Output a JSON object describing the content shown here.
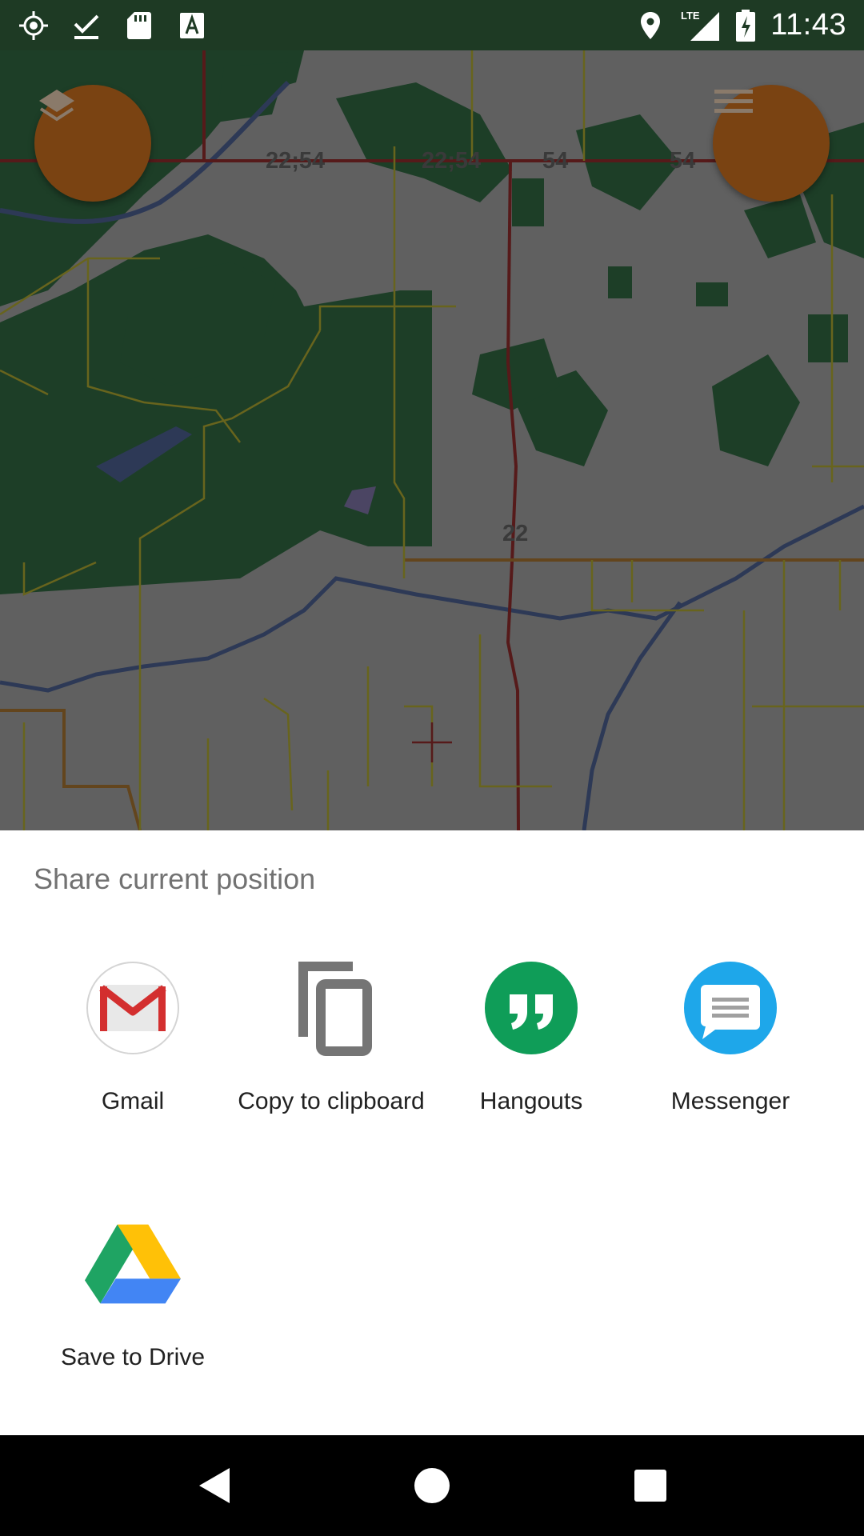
{
  "status_bar": {
    "time": "11:43",
    "network": "LTE",
    "icons": [
      "gps-icon",
      "download-done-icon",
      "sd-card-icon",
      "text-a-icon",
      "location-icon",
      "signal-icon",
      "battery-charging-icon"
    ]
  },
  "map": {
    "road_labels": [
      "22;54",
      "22;54",
      "54",
      "54",
      "22"
    ],
    "colors": {
      "forest": "#2f6440",
      "land": "#9b9b9b",
      "highway": "#8b2b2b",
      "minor_road": "#a8a230",
      "water": "#4a5d8c",
      "fab": "#7a4312"
    },
    "buttons": {
      "layers_icon": "layers-icon",
      "menu_icon": "menu-icon"
    }
  },
  "share_sheet": {
    "title": "Share current position",
    "items": [
      {
        "label": "Gmail",
        "icon": "gmail-icon"
      },
      {
        "label": "Copy to clipboard",
        "icon": "copy-icon"
      },
      {
        "label": "Hangouts",
        "icon": "hangouts-icon"
      },
      {
        "label": "Messenger",
        "icon": "messenger-icon"
      },
      {
        "label": "Save to Drive",
        "icon": "drive-icon"
      }
    ]
  },
  "nav_bar": {
    "icons": [
      "back-icon",
      "home-icon",
      "recents-icon"
    ]
  }
}
